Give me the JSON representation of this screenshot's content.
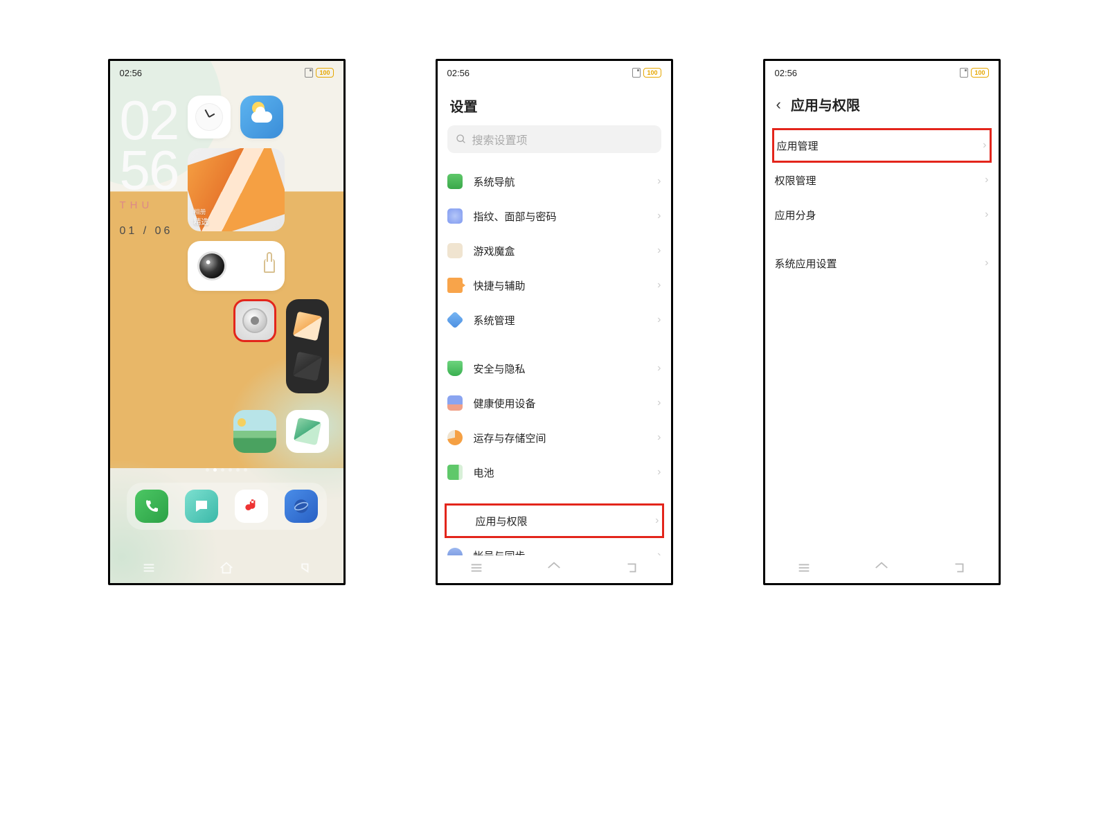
{
  "status": {
    "time": "02:56",
    "battery": "100"
  },
  "home": {
    "clock_h": "02",
    "clock_m": "56",
    "day": "THU",
    "date": "01 / 06",
    "gallery_tag": "相册",
    "gallery_title": "精选"
  },
  "settings": {
    "title": "设置",
    "search_placeholder": "搜索设置项",
    "items_g1": [
      {
        "label": "系统导航"
      },
      {
        "label": "指纹、面部与密码"
      },
      {
        "label": "游戏魔盒"
      },
      {
        "label": "快捷与辅助"
      },
      {
        "label": "系统管理"
      }
    ],
    "items_g2": [
      {
        "label": "安全与隐私"
      },
      {
        "label": "健康使用设备"
      },
      {
        "label": "运存与存储空间"
      },
      {
        "label": "电池"
      }
    ],
    "items_g3": [
      {
        "label": "应用与权限"
      },
      {
        "label": "帐号与同步"
      }
    ]
  },
  "perms": {
    "title": "应用与权限",
    "items_a": [
      {
        "label": "应用管理"
      },
      {
        "label": "权限管理"
      },
      {
        "label": "应用分身"
      }
    ],
    "items_b": [
      {
        "label": "系统应用设置"
      }
    ]
  }
}
